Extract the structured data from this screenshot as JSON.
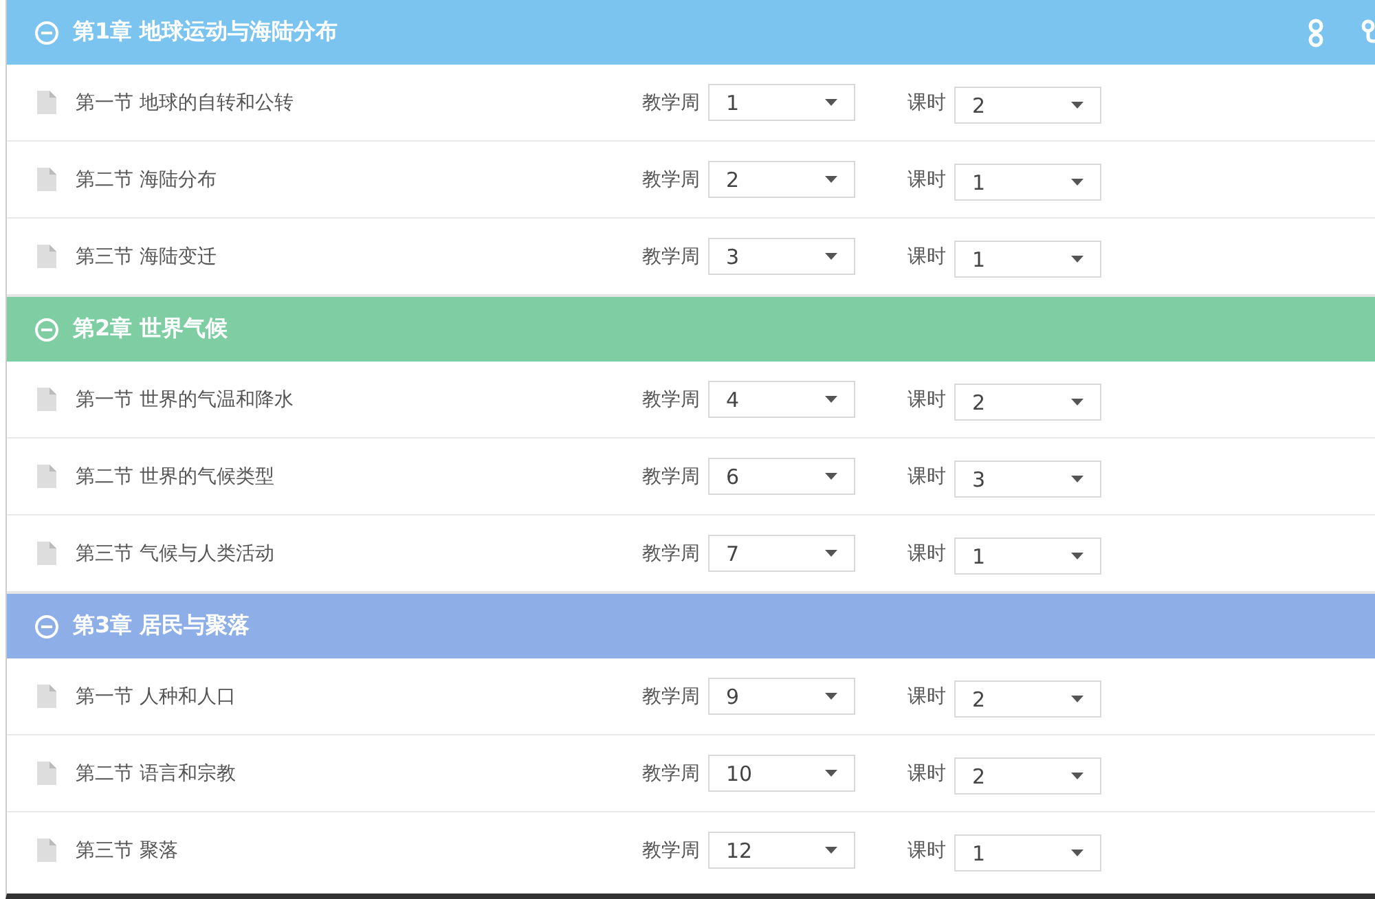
{
  "chapters": [
    {
      "title": "第1章 地球运动与海陆分布",
      "color": "#7cc4f0",
      "expanded": true,
      "show_tools": true,
      "sections": [
        {
          "title": "第一节 地球的自转和公转",
          "week_label": "教学周",
          "week": "1",
          "hours_label": "课时",
          "hours": "2"
        },
        {
          "title": "第二节 海陆分布",
          "week_label": "教学周",
          "week": "2",
          "hours_label": "课时",
          "hours": "1"
        },
        {
          "title": "第三节 海陆变迁",
          "week_label": "教学周",
          "week": "3",
          "hours_label": "课时",
          "hours": "1"
        }
      ]
    },
    {
      "title": "第2章 世界气候",
      "color": "#7ecda3",
      "expanded": true,
      "show_tools": false,
      "sections": [
        {
          "title": "第一节 世界的气温和降水",
          "week_label": "教学周",
          "week": "4",
          "hours_label": "课时",
          "hours": "2"
        },
        {
          "title": "第二节 世界的气候类型",
          "week_label": "教学周",
          "week": "6",
          "hours_label": "课时",
          "hours": "3"
        },
        {
          "title": "第三节 气候与人类活动",
          "week_label": "教学周",
          "week": "7",
          "hours_label": "课时",
          "hours": "1"
        }
      ]
    },
    {
      "title": "第3章 居民与聚落",
      "color": "#8eaee8",
      "expanded": true,
      "show_tools": false,
      "sections": [
        {
          "title": "第一节 人种和人口",
          "week_label": "教学周",
          "week": "9",
          "hours_label": "课时",
          "hours": "2"
        },
        {
          "title": "第二节 语言和宗教",
          "week_label": "教学周",
          "week": "10",
          "hours_label": "课时",
          "hours": "2"
        },
        {
          "title": "第三节 聚落",
          "week_label": "教学周",
          "week": "12",
          "hours_label": "课时",
          "hours": "1"
        }
      ]
    }
  ]
}
